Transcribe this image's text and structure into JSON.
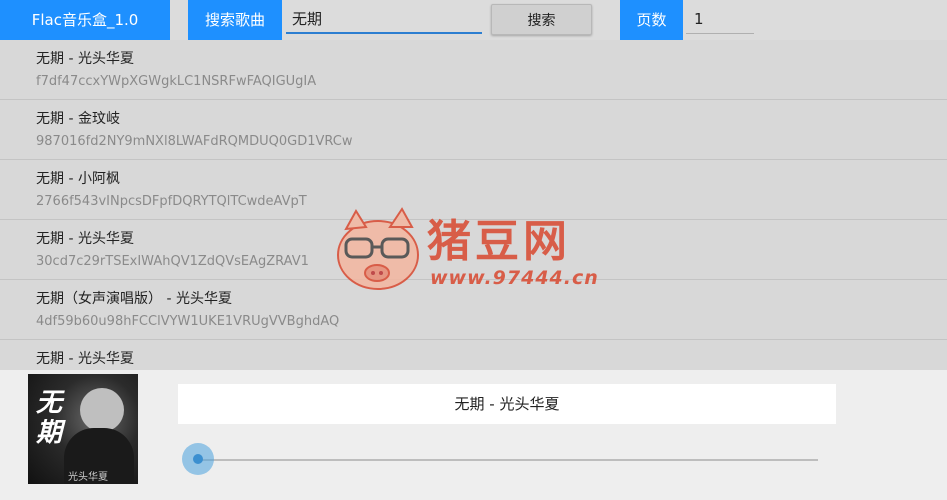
{
  "header": {
    "app_title": "Flac音乐盒_1.0",
    "search_label": "搜索歌曲",
    "search_value": "无期",
    "search_button": "搜索",
    "page_label": "页数",
    "page_value": "1"
  },
  "songs": [
    {
      "name": "无期 - 光头华夏",
      "id": "f7df47ccxYWpXGWgkLC1NSRFwFAQIGUgIA"
    },
    {
      "name": "无期 - 金玟岐",
      "id": "987016fd2NY9mNXl8LWAFdRQMDUQ0GD1VRCw"
    },
    {
      "name": "无期 - 小阿枫",
      "id": "2766f543vINpcsDFpfDQRYTQlTCwdeAVpT"
    },
    {
      "name": "无期 - 光头华夏",
      "id": "30cd7c29rTSExIWAhQV1ZdQVsEAgZRAV1"
    },
    {
      "name": "无期（女声演唱版） - 光头华夏",
      "id": "4df59b60u98hFCClVYW1UKE1VRUgVVBghdAQ"
    },
    {
      "name": "无期 - 光头华夏",
      "id": ""
    }
  ],
  "watermark": {
    "brand": "猪豆网",
    "url": "www.97444.cn"
  },
  "player": {
    "cover_title": "无期",
    "cover_artist": "光头华夏",
    "now_playing": "无期 - 光头华夏",
    "progress": 0.0,
    "accent_color": "#4aa3df"
  },
  "colors": {
    "header_blue": "#1e90ff",
    "list_bg": "#d8d8d8"
  }
}
